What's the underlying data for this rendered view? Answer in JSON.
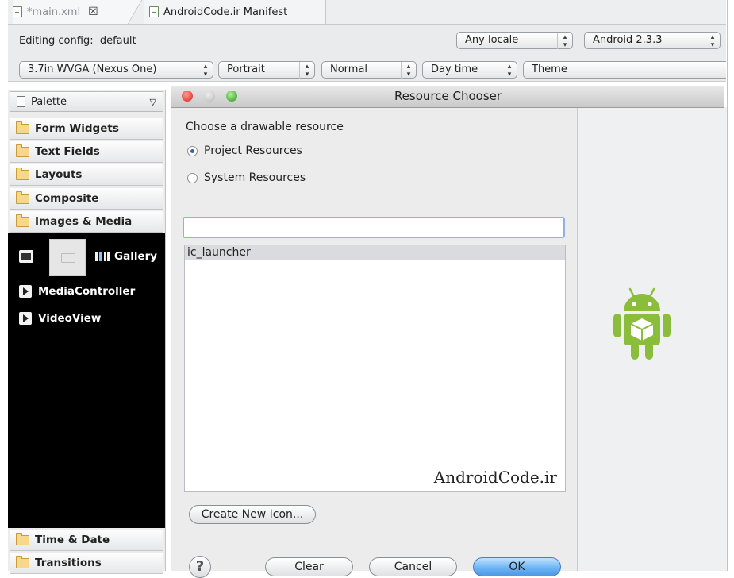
{
  "tabs": [
    {
      "label": "*main.xml",
      "close": "☒"
    },
    {
      "label": "AndroidCode.ir Manifest"
    }
  ],
  "config": {
    "label": "Editing config:",
    "value": "default",
    "locale": "Any locale",
    "target": "Android 2.3.3",
    "device": "3.7in WVGA (Nexus One)",
    "orientation": "Portrait",
    "mode": "Normal",
    "time": "Day time",
    "theme": "Theme"
  },
  "palette": {
    "title": "Palette",
    "categories": [
      "Form Widgets",
      "Text Fields",
      "Layouts",
      "Composite",
      "Images & Media",
      "Time & Date",
      "Transitions"
    ],
    "media_items": [
      "Gallery",
      "MediaController",
      "VideoView"
    ]
  },
  "dialog": {
    "title": "Resource Chooser",
    "prompt": "Choose a drawable resource",
    "radio_project": "Project Resources",
    "radio_system": "System Resources",
    "selected_radio": "Project Resources",
    "filter_value": "",
    "resources": [
      "ic_launcher"
    ],
    "watermark": "AndroidCode.ir",
    "create_new_icon": "Create New Icon...",
    "clear": "Clear",
    "cancel": "Cancel",
    "ok": "OK",
    "help": "?"
  },
  "colors": {
    "android_green": "#8bbd3c",
    "ok_button": "#6fb5f5",
    "close_light": "#e8504a",
    "zoom_light": "#5dbb4a"
  }
}
